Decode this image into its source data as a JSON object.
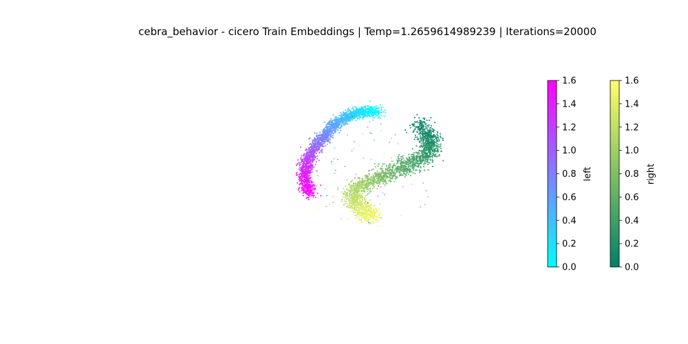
{
  "chart_data": {
    "type": "scatter",
    "title": "cebra_behavior - cicero Train Embeddings | Temp=1.2659614989239 | Iterations=20000",
    "xlabel": "",
    "ylabel": "",
    "grid": false,
    "axes_visible": false,
    "series": [
      {
        "name": "left",
        "colormap": "cool",
        "color_range": [
          0.0,
          1.6
        ],
        "path_description": "arc along the upper-left rim of the ellipse, value rising from top (0.0) to left side (1.6)",
        "points": [
          {
            "x": 0.12,
            "y": 0.98,
            "c": 0.0
          },
          {
            "x": -0.1,
            "y": 0.97,
            "c": 0.15
          },
          {
            "x": -0.3,
            "y": 0.9,
            "c": 0.35
          },
          {
            "x": -0.48,
            "y": 0.75,
            "c": 0.55
          },
          {
            "x": -0.62,
            "y": 0.55,
            "c": 0.75
          },
          {
            "x": -0.75,
            "y": 0.35,
            "c": 1.0
          },
          {
            "x": -0.85,
            "y": 0.12,
            "c": 1.25
          },
          {
            "x": -0.88,
            "y": -0.12,
            "c": 1.45
          },
          {
            "x": -0.8,
            "y": -0.4,
            "c": 1.6
          }
        ]
      },
      {
        "name": "right",
        "colormap": "summer",
        "color_range": [
          0.0,
          1.6
        ],
        "path_description": "S-shaped band from upper-right rim through the centre to the bottom, value rising from 0.0 to 1.6",
        "points": [
          {
            "x": 0.68,
            "y": 0.78,
            "c": 0.0
          },
          {
            "x": 0.82,
            "y": 0.5,
            "c": 0.15
          },
          {
            "x": 0.8,
            "y": 0.3,
            "c": 0.25
          },
          {
            "x": 0.55,
            "y": 0.1,
            "c": 0.45
          },
          {
            "x": 0.25,
            "y": -0.05,
            "c": 0.7
          },
          {
            "x": -0.05,
            "y": -0.2,
            "c": 0.95
          },
          {
            "x": -0.25,
            "y": -0.4,
            "c": 1.15
          },
          {
            "x": -0.1,
            "y": -0.65,
            "c": 1.35
          },
          {
            "x": 0.05,
            "y": -0.75,
            "c": 1.55
          }
        ]
      }
    ],
    "colorbars": [
      {
        "label": "left",
        "colormap": "cool",
        "colors": [
          "#00ffff",
          "#ff00ff"
        ],
        "range": [
          0.0,
          1.6
        ],
        "ticks": [
          "0.0",
          "0.2",
          "0.4",
          "0.6",
          "0.8",
          "1.0",
          "1.2",
          "1.4",
          "1.6"
        ]
      },
      {
        "label": "right",
        "colormap": "summer",
        "colors": [
          "#008066",
          "#ffff66"
        ],
        "range": [
          0.0,
          1.6
        ],
        "ticks": [
          "0.0",
          "0.2",
          "0.4",
          "0.6",
          "0.8",
          "1.0",
          "1.2",
          "1.4",
          "1.6"
        ]
      }
    ]
  }
}
